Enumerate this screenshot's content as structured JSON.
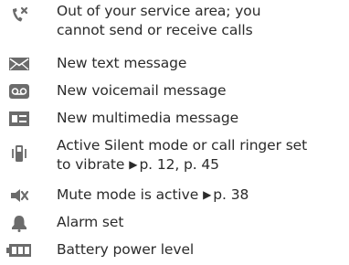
{
  "icon_list": [
    {
      "icon": "no-service-icon",
      "lines": [
        {
          "text": "Out of your service area; you"
        },
        {
          "text": "cannot send or receive calls"
        }
      ]
    },
    {
      "icon": "text-message-icon",
      "lines": [
        {
          "text": "New text message"
        }
      ]
    },
    {
      "icon": "voicemail-icon",
      "lines": [
        {
          "text": "New voicemail message"
        }
      ]
    },
    {
      "icon": "multimedia-message-icon",
      "lines": [
        {
          "text": "New multimedia message"
        }
      ]
    },
    {
      "icon": "vibrate-icon",
      "lines": [
        {
          "text": "Active Silent mode or call ringer set"
        },
        {
          "text": "to vibrate",
          "arrow": "▶",
          "ref": "p. 12, p. 45"
        }
      ]
    },
    {
      "icon": "mute-icon",
      "lines": [
        {
          "text": "Mute mode is active",
          "arrow": "▶",
          "ref": "p. 38"
        }
      ]
    },
    {
      "icon": "alarm-icon",
      "lines": [
        {
          "text": "Alarm set"
        }
      ]
    },
    {
      "icon": "battery-icon",
      "lines": [
        {
          "text": "Battery power level"
        }
      ]
    }
  ]
}
